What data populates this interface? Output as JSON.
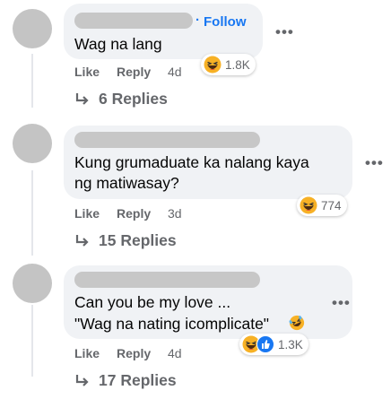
{
  "comments": [
    {
      "follow_label": "Follow",
      "text_lines": [
        "Wag na lang"
      ],
      "like_label": "Like",
      "reply_label": "Reply",
      "time": "4d",
      "reaction_count": "1.8K",
      "reaction_icons": [
        "haha-emoji-icon"
      ],
      "replies_label": "6 Replies"
    },
    {
      "text_lines": [
        "Kung grumaduate ka nalang kaya",
        "ng matiwasay?"
      ],
      "like_label": "Like",
      "reply_label": "Reply",
      "time": "3d",
      "reaction_count": "774",
      "reaction_icons": [
        "haha-emoji-icon"
      ],
      "replies_label": "15 Replies"
    },
    {
      "text_lines": [
        "Can you be my love ...",
        "\"Wag na nating icomplicate\""
      ],
      "like_label": "Like",
      "reply_label": "Reply",
      "time": "4d",
      "reaction_count": "1.3K",
      "reaction_icons": [
        "haha-emoji-icon",
        "like-thumb-icon"
      ],
      "replies_label": "17 Replies"
    }
  ],
  "colors": {
    "bubble": "#f0f2f5",
    "link_blue": "#1877f2",
    "secondary_text": "#65676b",
    "avatar_placeholder": "#c4c4c4",
    "redacted_name": "#c7c7c7"
  }
}
